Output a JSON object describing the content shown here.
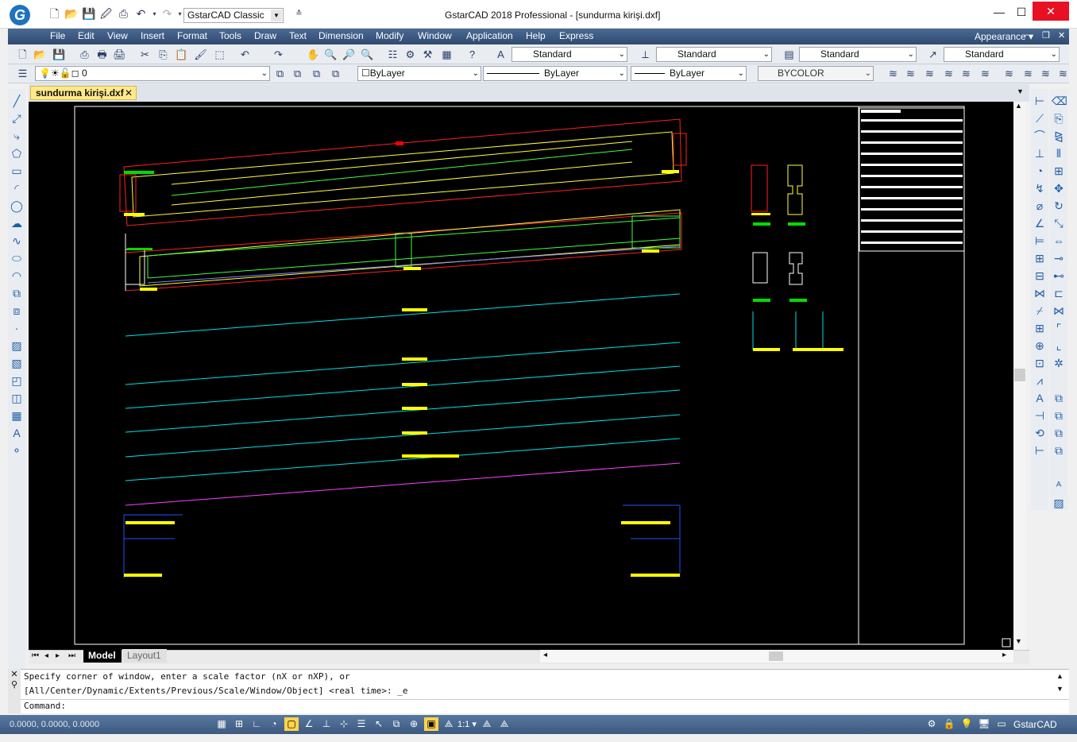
{
  "window": {
    "title": "GstarCAD 2018 Professional - [sundurma kirişi.dxf]",
    "workspace": "GstarCAD Classic",
    "logo_letter": "G"
  },
  "menu": [
    "File",
    "Edit",
    "View",
    "Insert",
    "Format",
    "Tools",
    "Draw",
    "Text",
    "Dimension",
    "Modify",
    "Window",
    "Application",
    "Help",
    "Express"
  ],
  "appearance_label": "Appearance",
  "styles_toolbar": {
    "text_style": "Standard",
    "dim_style": "Standard",
    "table_style": "Standard",
    "multileader_style": "Standard"
  },
  "layer_toolbar": {
    "layer": "0",
    "color": "ByLayer",
    "linetype": "ByLayer",
    "lineweight": "ByLayer",
    "plot_style": "BYCOLOR"
  },
  "document_tab": "sundurma kirişi.dxf",
  "layout_tabs": [
    "Model",
    "Layout1"
  ],
  "command": {
    "history": [
      "Specify corner of window, enter a scale factor (nX or nXP), or",
      "[All/Center/Dynamic/Extents/Previous/Scale/Window/Object] <real time>: _e"
    ],
    "prompt": "Command:"
  },
  "status": {
    "coordinates": "0.0000, 0.0000, 0.0000",
    "annotation_scale": "1:1",
    "brand": "GstarCAD"
  },
  "colors": {
    "menubar": "#3d5a80",
    "canvas": "#000000",
    "close_button": "#e81123",
    "doc_tab": "#ffe98a"
  }
}
